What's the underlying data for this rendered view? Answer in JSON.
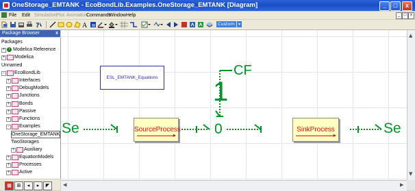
{
  "window": {
    "title": "OneStorage_EMTANK - EcoBondLib.Examples.OneStorage_EMTANK [Diagram]",
    "buttons": [
      "_",
      "□",
      "x"
    ]
  },
  "menu": {
    "items": [
      "File",
      "Edit",
      "Simulation",
      "Plot",
      "Animation",
      "Commands",
      "Window",
      "Help"
    ],
    "disabled": [
      false,
      false,
      true,
      true,
      true,
      false,
      false,
      false
    ]
  },
  "toolbar": {
    "custom_label": "Custom"
  },
  "package_browser": {
    "title": "Package Browser",
    "close": "x",
    "items": [
      {
        "label": "Packages",
        "indent": 0,
        "expander": "",
        "icon": "none"
      },
      {
        "label": "Modelica Reference",
        "indent": 0,
        "expander": "+",
        "icon": "info"
      },
      {
        "label": "Modelica",
        "indent": 0,
        "expander": "+",
        "icon": "folder"
      },
      {
        "label": "Unnamed",
        "indent": 0,
        "expander": "",
        "icon": "none"
      },
      {
        "label": "EcoBondLib",
        "indent": 0,
        "expander": "-",
        "icon": "folder"
      },
      {
        "label": "Interfaces",
        "indent": 1,
        "expander": "+",
        "icon": "folder"
      },
      {
        "label": "DebugModels",
        "indent": 1,
        "expander": "+",
        "icon": "folder"
      },
      {
        "label": "Junctions",
        "indent": 1,
        "expander": "+",
        "icon": "folder"
      },
      {
        "label": "Bonds",
        "indent": 1,
        "expander": "+",
        "icon": "folder"
      },
      {
        "label": "Passive",
        "indent": 1,
        "expander": "+",
        "icon": "folder"
      },
      {
        "label": "Functions",
        "indent": 1,
        "expander": "+",
        "icon": "folder"
      },
      {
        "label": "Examples",
        "indent": 1,
        "expander": "-",
        "icon": "folder"
      },
      {
        "label": "OneStorage_EMTANK",
        "indent": 2,
        "expander": "",
        "icon": "none",
        "selected": true
      },
      {
        "label": "TwoStorages",
        "indent": 2,
        "expander": "",
        "icon": "none"
      },
      {
        "label": "Auxiliary",
        "indent": 2,
        "expander": "+",
        "icon": "folder"
      },
      {
        "label": "EquationModels",
        "indent": 1,
        "expander": "+",
        "icon": "folder"
      },
      {
        "label": "Processes",
        "indent": 1,
        "expander": "+",
        "icon": "folder"
      },
      {
        "label": "Active",
        "indent": 1,
        "expander": "+",
        "icon": "folder"
      }
    ]
  },
  "diagram": {
    "equations_label": "ESL_EMTANK_Equations",
    "source_process": "SourceProcess",
    "sink_process": "SinkProcess",
    "se_left": "Se",
    "se_right": "Se",
    "cf_label": "CF",
    "junction_one": "1",
    "junction_zero": "0"
  },
  "colors": {
    "bond": "#00922a",
    "process_text": "#d80d0d",
    "process_fill": "#ffffc0",
    "equations_border": "#2c2cb2"
  }
}
